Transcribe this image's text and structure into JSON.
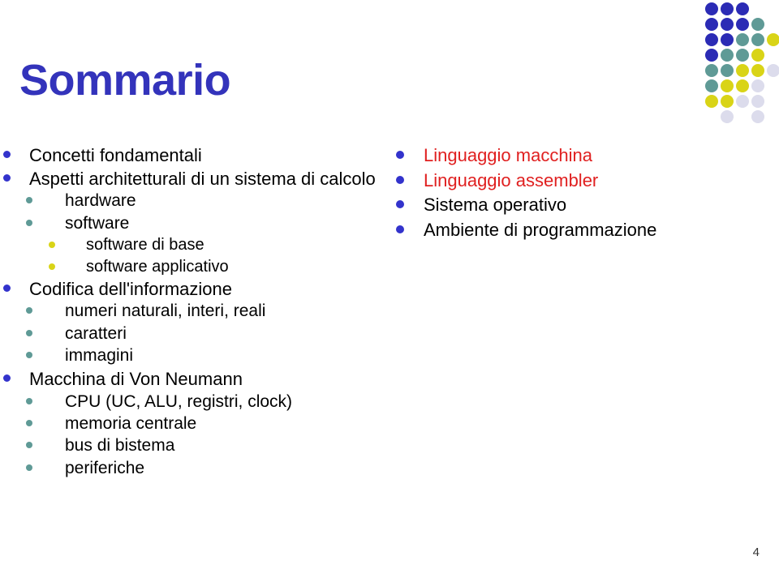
{
  "slide": {
    "title": "Sommario",
    "number": "4",
    "title_color": "#3333bb",
    "background_color": "#ffffff"
  },
  "left_column": [
    {
      "level": 1,
      "text": "Concetti fondamentali"
    },
    {
      "level": 1,
      "text": "Aspetti architetturali di un sistema di calcolo"
    },
    {
      "level": 2,
      "text": "hardware"
    },
    {
      "level": 2,
      "text": "software"
    },
    {
      "level": 3,
      "text": "software di base"
    },
    {
      "level": 3,
      "text": "software applicativo"
    },
    {
      "level": 1,
      "text": "Codifica dell'informazione"
    },
    {
      "level": 2,
      "text": "numeri naturali, interi, reali"
    },
    {
      "level": 2,
      "text": "caratteri"
    },
    {
      "level": 2,
      "text": "immagini"
    },
    {
      "level": 1,
      "text": "Macchina di Von Neumann"
    },
    {
      "level": 2,
      "text": "CPU (UC, ALU, registri, clock)"
    },
    {
      "level": 2,
      "text": "memoria centrale"
    },
    {
      "level": 2,
      "text": "bus di bistema"
    },
    {
      "level": 2,
      "text": "periferiche"
    }
  ],
  "right_column": [
    {
      "text": "Linguaggio macchina",
      "color": "red"
    },
    {
      "text": "Linguaggio assembler",
      "color": "red"
    },
    {
      "text": "Sistema operativo",
      "color": "black"
    },
    {
      "text": "Ambiente di programmazione",
      "color": "black"
    }
  ],
  "bullet_colors": {
    "level1": "#3333cc",
    "level2": "#5f9a96",
    "level3": "#d9d417",
    "right": "#3333cc"
  },
  "text_colors": {
    "body": "#000000",
    "highlight": "#e02020"
  },
  "logo": {
    "name": "dot-matrix-logo",
    "colors": {
      "b": "#2b2bb5",
      "t": "#5f9a96",
      "y": "#d9d417",
      "p": "#dcdcec"
    },
    "cell": 19,
    "grid": [
      [
        "b",
        "b",
        "b",
        "",
        ""
      ],
      [
        "b",
        "b",
        "b",
        "t",
        ""
      ],
      [
        "b",
        "b",
        "t",
        "t",
        "y"
      ],
      [
        "b",
        "t",
        "t",
        "y",
        ""
      ],
      [
        "t",
        "t",
        "y",
        "y",
        "p"
      ],
      [
        "t",
        "y",
        "y",
        "p",
        ""
      ],
      [
        "y",
        "y",
        "p",
        "p",
        ""
      ],
      [
        "",
        "p",
        "",
        "p",
        ""
      ]
    ]
  }
}
